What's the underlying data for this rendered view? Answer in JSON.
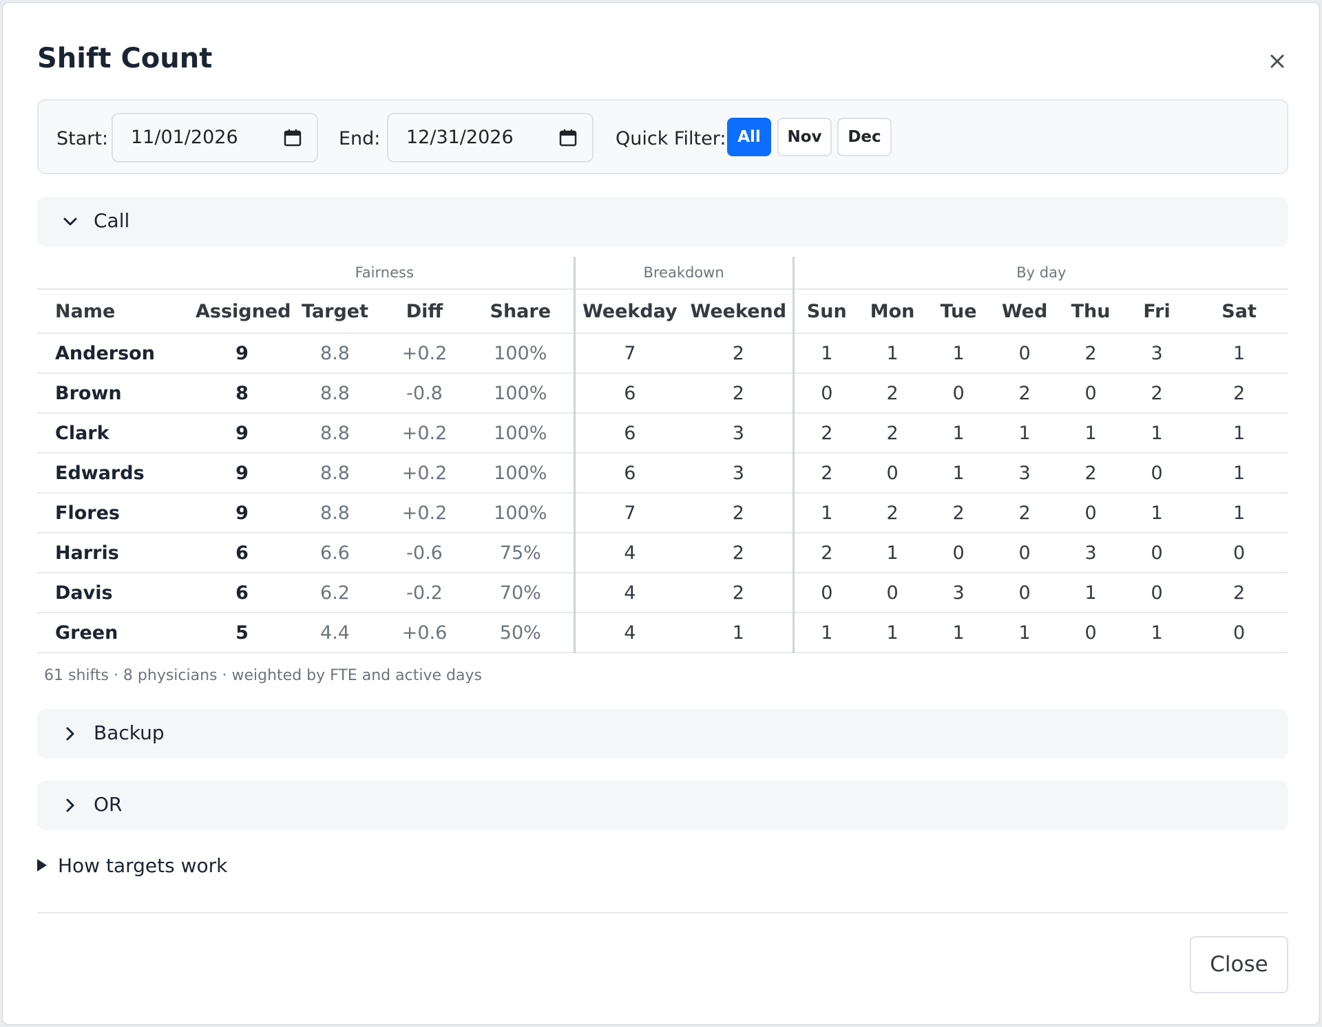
{
  "dialog": {
    "title": "Shift Count",
    "close_button": "Close"
  },
  "filters": {
    "start_label": "Start:",
    "start_value": "11/01/2026",
    "end_label": "End:",
    "end_value": "12/31/2026",
    "quick_label": "Quick Filter:",
    "quick_options": [
      "All",
      "Nov",
      "Dec"
    ],
    "quick_selected": "All"
  },
  "sections": {
    "call": {
      "label": "Call",
      "expanded": true
    },
    "backup": {
      "label": "Backup",
      "expanded": false
    },
    "or": {
      "label": "OR",
      "expanded": false
    }
  },
  "table": {
    "groups": {
      "fairness": "Fairness",
      "breakdown": "Breakdown",
      "by_day": "By day"
    },
    "columns": [
      "Name",
      "Assigned",
      "Target",
      "Diff",
      "Share",
      "Weekday",
      "Weekend",
      "Sun",
      "Mon",
      "Tue",
      "Wed",
      "Thu",
      "Fri",
      "Sat"
    ],
    "rows": [
      [
        "Anderson",
        "9",
        "8.8",
        "+0.2",
        "100%",
        "7",
        "2",
        "1",
        "1",
        "1",
        "0",
        "2",
        "3",
        "1"
      ],
      [
        "Brown",
        "8",
        "8.8",
        "-0.8",
        "100%",
        "6",
        "2",
        "0",
        "2",
        "0",
        "2",
        "0",
        "2",
        "2"
      ],
      [
        "Clark",
        "9",
        "8.8",
        "+0.2",
        "100%",
        "6",
        "3",
        "2",
        "2",
        "1",
        "1",
        "1",
        "1",
        "1"
      ],
      [
        "Edwards",
        "9",
        "8.8",
        "+0.2",
        "100%",
        "6",
        "3",
        "2",
        "0",
        "1",
        "3",
        "2",
        "0",
        "1"
      ],
      [
        "Flores",
        "9",
        "8.8",
        "+0.2",
        "100%",
        "7",
        "2",
        "1",
        "2",
        "2",
        "2",
        "0",
        "1",
        "1"
      ],
      [
        "Harris",
        "6",
        "6.6",
        "-0.6",
        "75%",
        "4",
        "2",
        "2",
        "1",
        "0",
        "0",
        "3",
        "0",
        "0"
      ],
      [
        "Davis",
        "6",
        "6.2",
        "-0.2",
        "70%",
        "4",
        "2",
        "0",
        "0",
        "3",
        "0",
        "1",
        "0",
        "2"
      ],
      [
        "Green",
        "5",
        "4.4",
        "+0.6",
        "50%",
        "4",
        "1",
        "1",
        "1",
        "1",
        "1",
        "0",
        "1",
        "0"
      ]
    ],
    "summary": "61 shifts · 8 physicians · weighted by FTE and active days"
  },
  "help": {
    "label": "How targets work"
  },
  "colors": {
    "accent": "#0d6efd",
    "text": "#1b2431",
    "muted": "#6c757d"
  }
}
